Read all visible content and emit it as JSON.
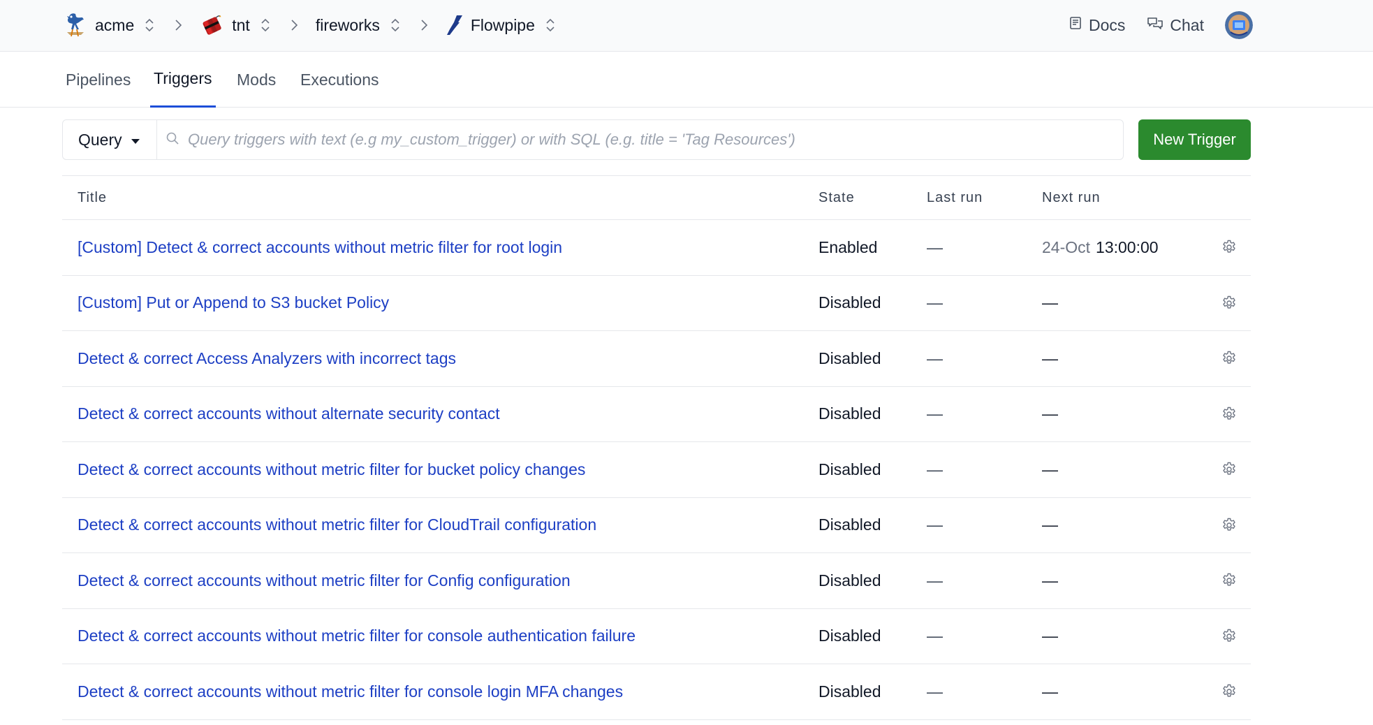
{
  "breadcrumbs": [
    {
      "label": "acme",
      "icon": "roadrunner-logo"
    },
    {
      "label": "tnt",
      "icon": "tnt-dynamite-logo"
    },
    {
      "label": "fireworks",
      "icon": ""
    },
    {
      "label": "Flowpipe",
      "icon": "flowpipe-logo"
    }
  ],
  "header": {
    "docs_label": "Docs",
    "chat_label": "Chat"
  },
  "tabs": [
    {
      "label": "Pipelines",
      "active": false
    },
    {
      "label": "Triggers",
      "active": true
    },
    {
      "label": "Mods",
      "active": false
    },
    {
      "label": "Executions",
      "active": false
    }
  ],
  "toolbar": {
    "query_label": "Query",
    "search_placeholder": "Query triggers with text (e.g my_custom_trigger) or with SQL (e.g. title = 'Tag Resources')",
    "search_value": "",
    "new_trigger_label": "New Trigger"
  },
  "table": {
    "columns": [
      "Title",
      "State",
      "Last run",
      "Next run"
    ],
    "rows": [
      {
        "title": "[Custom] Detect & correct accounts without metric filter for root login",
        "state": "Enabled",
        "last_run": "—",
        "next_run_date": "24-Oct",
        "next_run_time": "13:00:00"
      },
      {
        "title": "[Custom] Put or Append to S3 bucket Policy",
        "state": "Disabled",
        "last_run": "—",
        "next_run_date": "",
        "next_run_time": "—"
      },
      {
        "title": "Detect & correct Access Analyzers with incorrect tags",
        "state": "Disabled",
        "last_run": "—",
        "next_run_date": "",
        "next_run_time": "—"
      },
      {
        "title": "Detect & correct accounts without alternate security contact",
        "state": "Disabled",
        "last_run": "—",
        "next_run_date": "",
        "next_run_time": "—"
      },
      {
        "title": "Detect & correct accounts without metric filter for bucket policy changes",
        "state": "Disabled",
        "last_run": "—",
        "next_run_date": "",
        "next_run_time": "—"
      },
      {
        "title": "Detect & correct accounts without metric filter for CloudTrail configuration",
        "state": "Disabled",
        "last_run": "—",
        "next_run_date": "",
        "next_run_time": "—"
      },
      {
        "title": "Detect & correct accounts without metric filter for Config configuration",
        "state": "Disabled",
        "last_run": "—",
        "next_run_date": "",
        "next_run_time": "—"
      },
      {
        "title": "Detect & correct accounts without metric filter for console authentication failure",
        "state": "Disabled",
        "last_run": "—",
        "next_run_date": "",
        "next_run_time": "—"
      },
      {
        "title": "Detect & correct accounts without metric filter for console login MFA changes",
        "state": "Disabled",
        "last_run": "—",
        "next_run_date": "",
        "next_run_time": "—"
      }
    ]
  },
  "colors": {
    "link": "#1d3fc4",
    "primary_button": "#2b8a2e",
    "active_tab_underline": "#1d4ed8"
  }
}
